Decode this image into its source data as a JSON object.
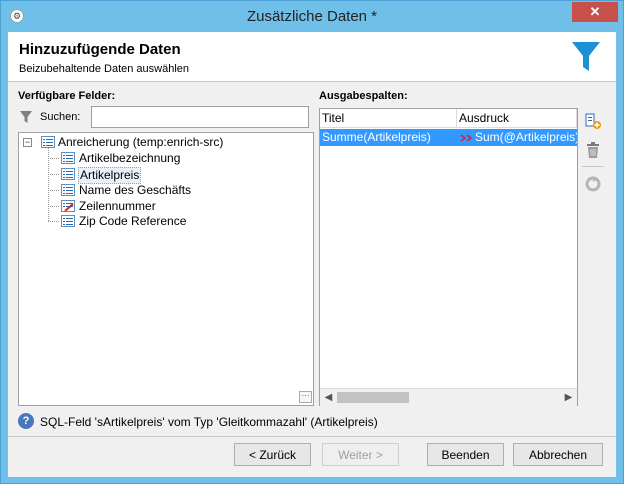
{
  "window": {
    "title": "Zusätzliche Daten *",
    "close": "✕"
  },
  "header": {
    "title": "Hinzuzufügende Daten",
    "subtitle": "Beizubehaltende Daten auswählen"
  },
  "left": {
    "label": "Verfügbare Felder:",
    "search_label": "Suchen:",
    "search_value": "",
    "tree": {
      "root": "Anreicherung (temp:enrich-src)",
      "children": [
        "Artikelbezeichnung",
        "Artikelpreis",
        "Name des Geschäfts",
        "Zeilennummer",
        "Zip Code Reference"
      ]
    }
  },
  "right": {
    "label": "Ausgabespalten:",
    "columns": [
      "Titel",
      "Ausdruck"
    ],
    "rows": [
      {
        "title": "Summe(Artikelpreis)",
        "expr": "Sum(@Artikelpreis)"
      }
    ]
  },
  "status": {
    "text": "SQL-Feld 'sArtikelpreis' vom Typ 'Gleitkommazahl' (Artikelpreis)"
  },
  "buttons": {
    "back": "< Zurück",
    "next": "Weiter >",
    "finish": "Beenden",
    "cancel": "Abbrechen"
  },
  "icons": {
    "funnel_color": "#1e90d8",
    "accent_selection": "#3399ff"
  }
}
